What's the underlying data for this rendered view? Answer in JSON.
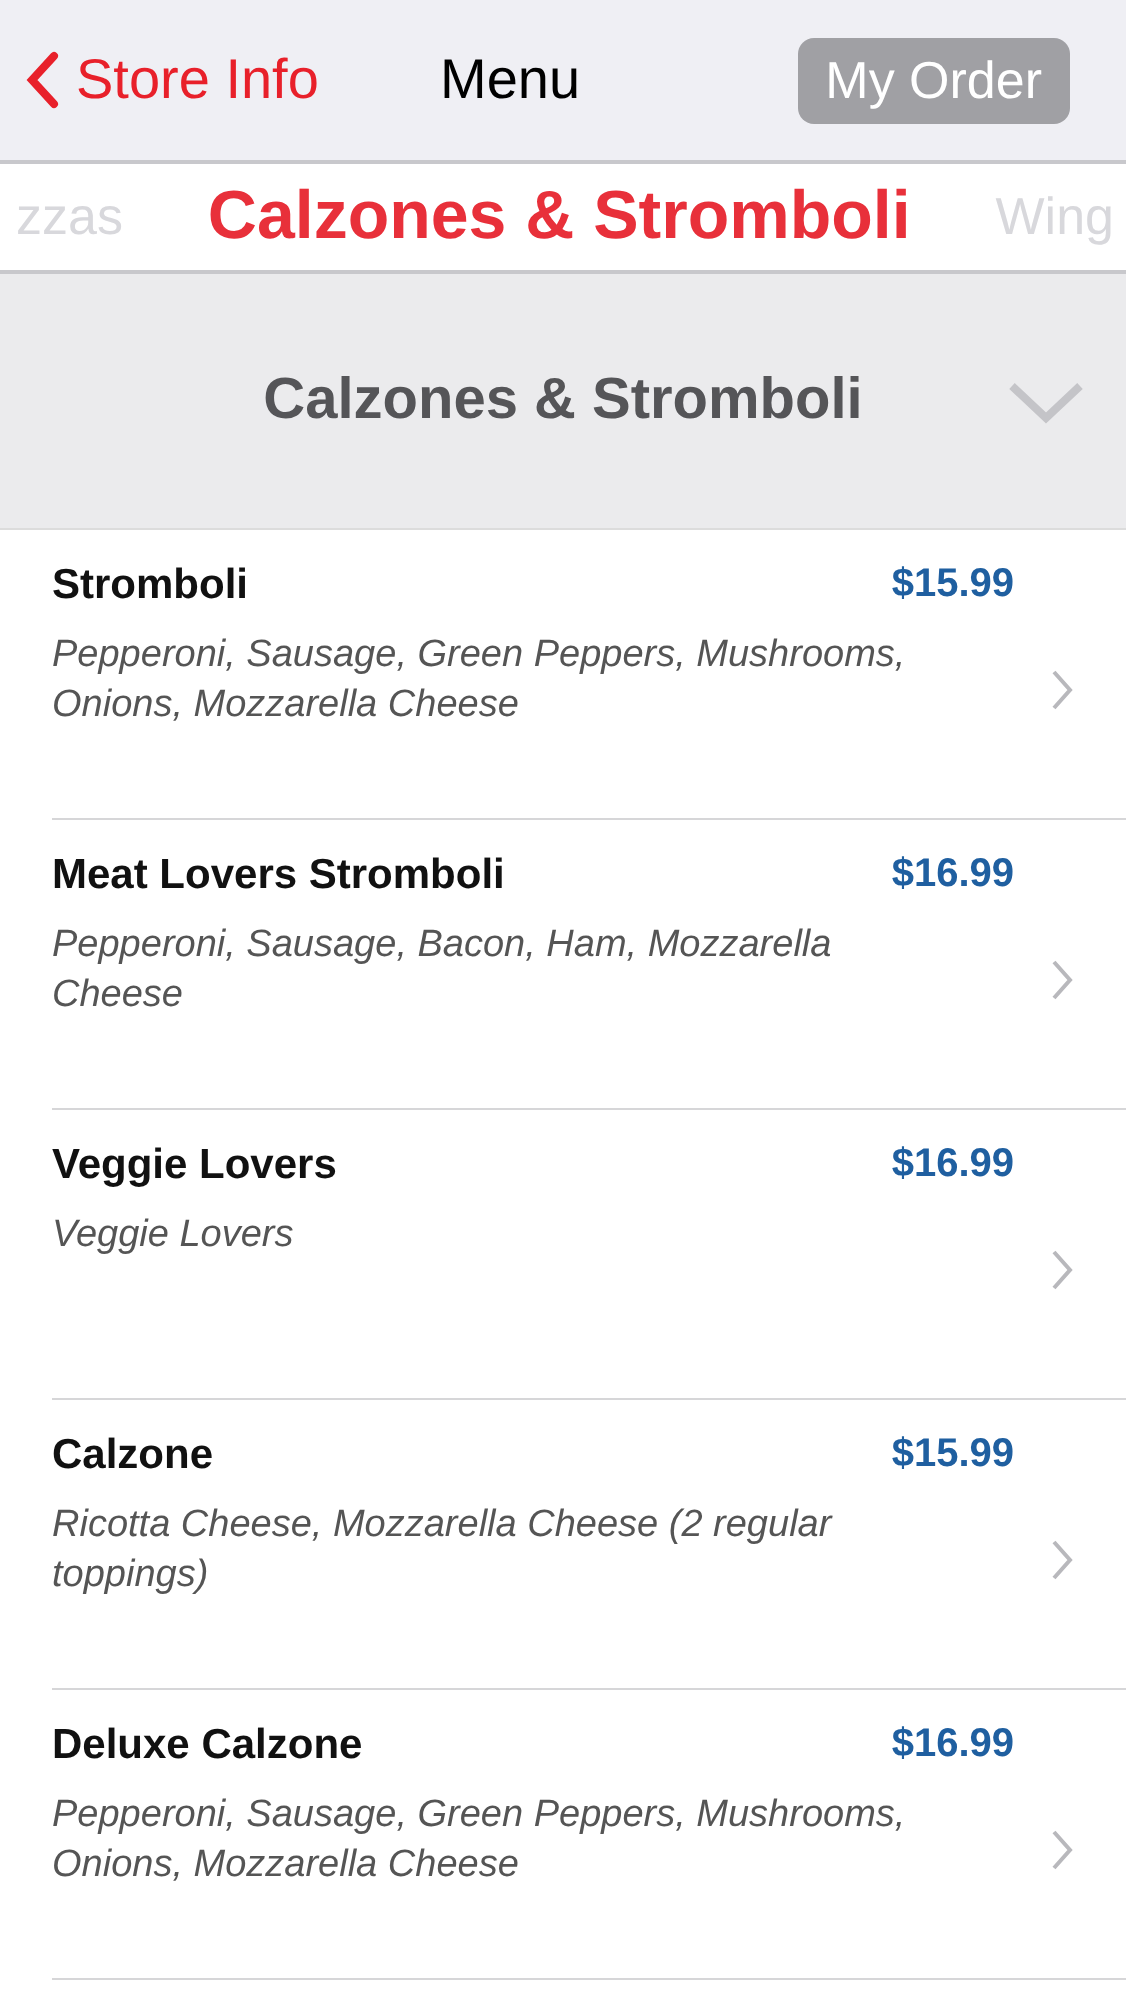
{
  "nav": {
    "back": "Store Info",
    "title": "Menu",
    "order_button": "My Order"
  },
  "categories": [
    {
      "label": "zzas",
      "selected": false
    },
    {
      "label": "Calzones & Stromboli",
      "selected": true
    },
    {
      "label": "Wing",
      "selected": false
    }
  ],
  "section": {
    "title": "Calzones & Stromboli",
    "expanded": true
  },
  "items": [
    {
      "name": "Stromboli",
      "price": "$15.99",
      "description": "Pepperoni, Sausage, Green Peppers, Mushrooms, Onions, Mozzarella Cheese"
    },
    {
      "name": "Meat Lovers Stromboli",
      "price": "$16.99",
      "description": "Pepperoni, Sausage, Bacon, Ham, Mozzarella Cheese"
    },
    {
      "name": "Veggie Lovers",
      "price": "$16.99",
      "description": "Veggie Lovers"
    },
    {
      "name": "Calzone",
      "price": "$15.99",
      "description": "Ricotta Cheese, Mozzarella Cheese (2 regular toppings)"
    },
    {
      "name": "Deluxe Calzone",
      "price": "$16.99",
      "description": "Pepperoni, Sausage, Green Peppers, Mushrooms, Onions, Mozzarella Cheese"
    }
  ]
}
